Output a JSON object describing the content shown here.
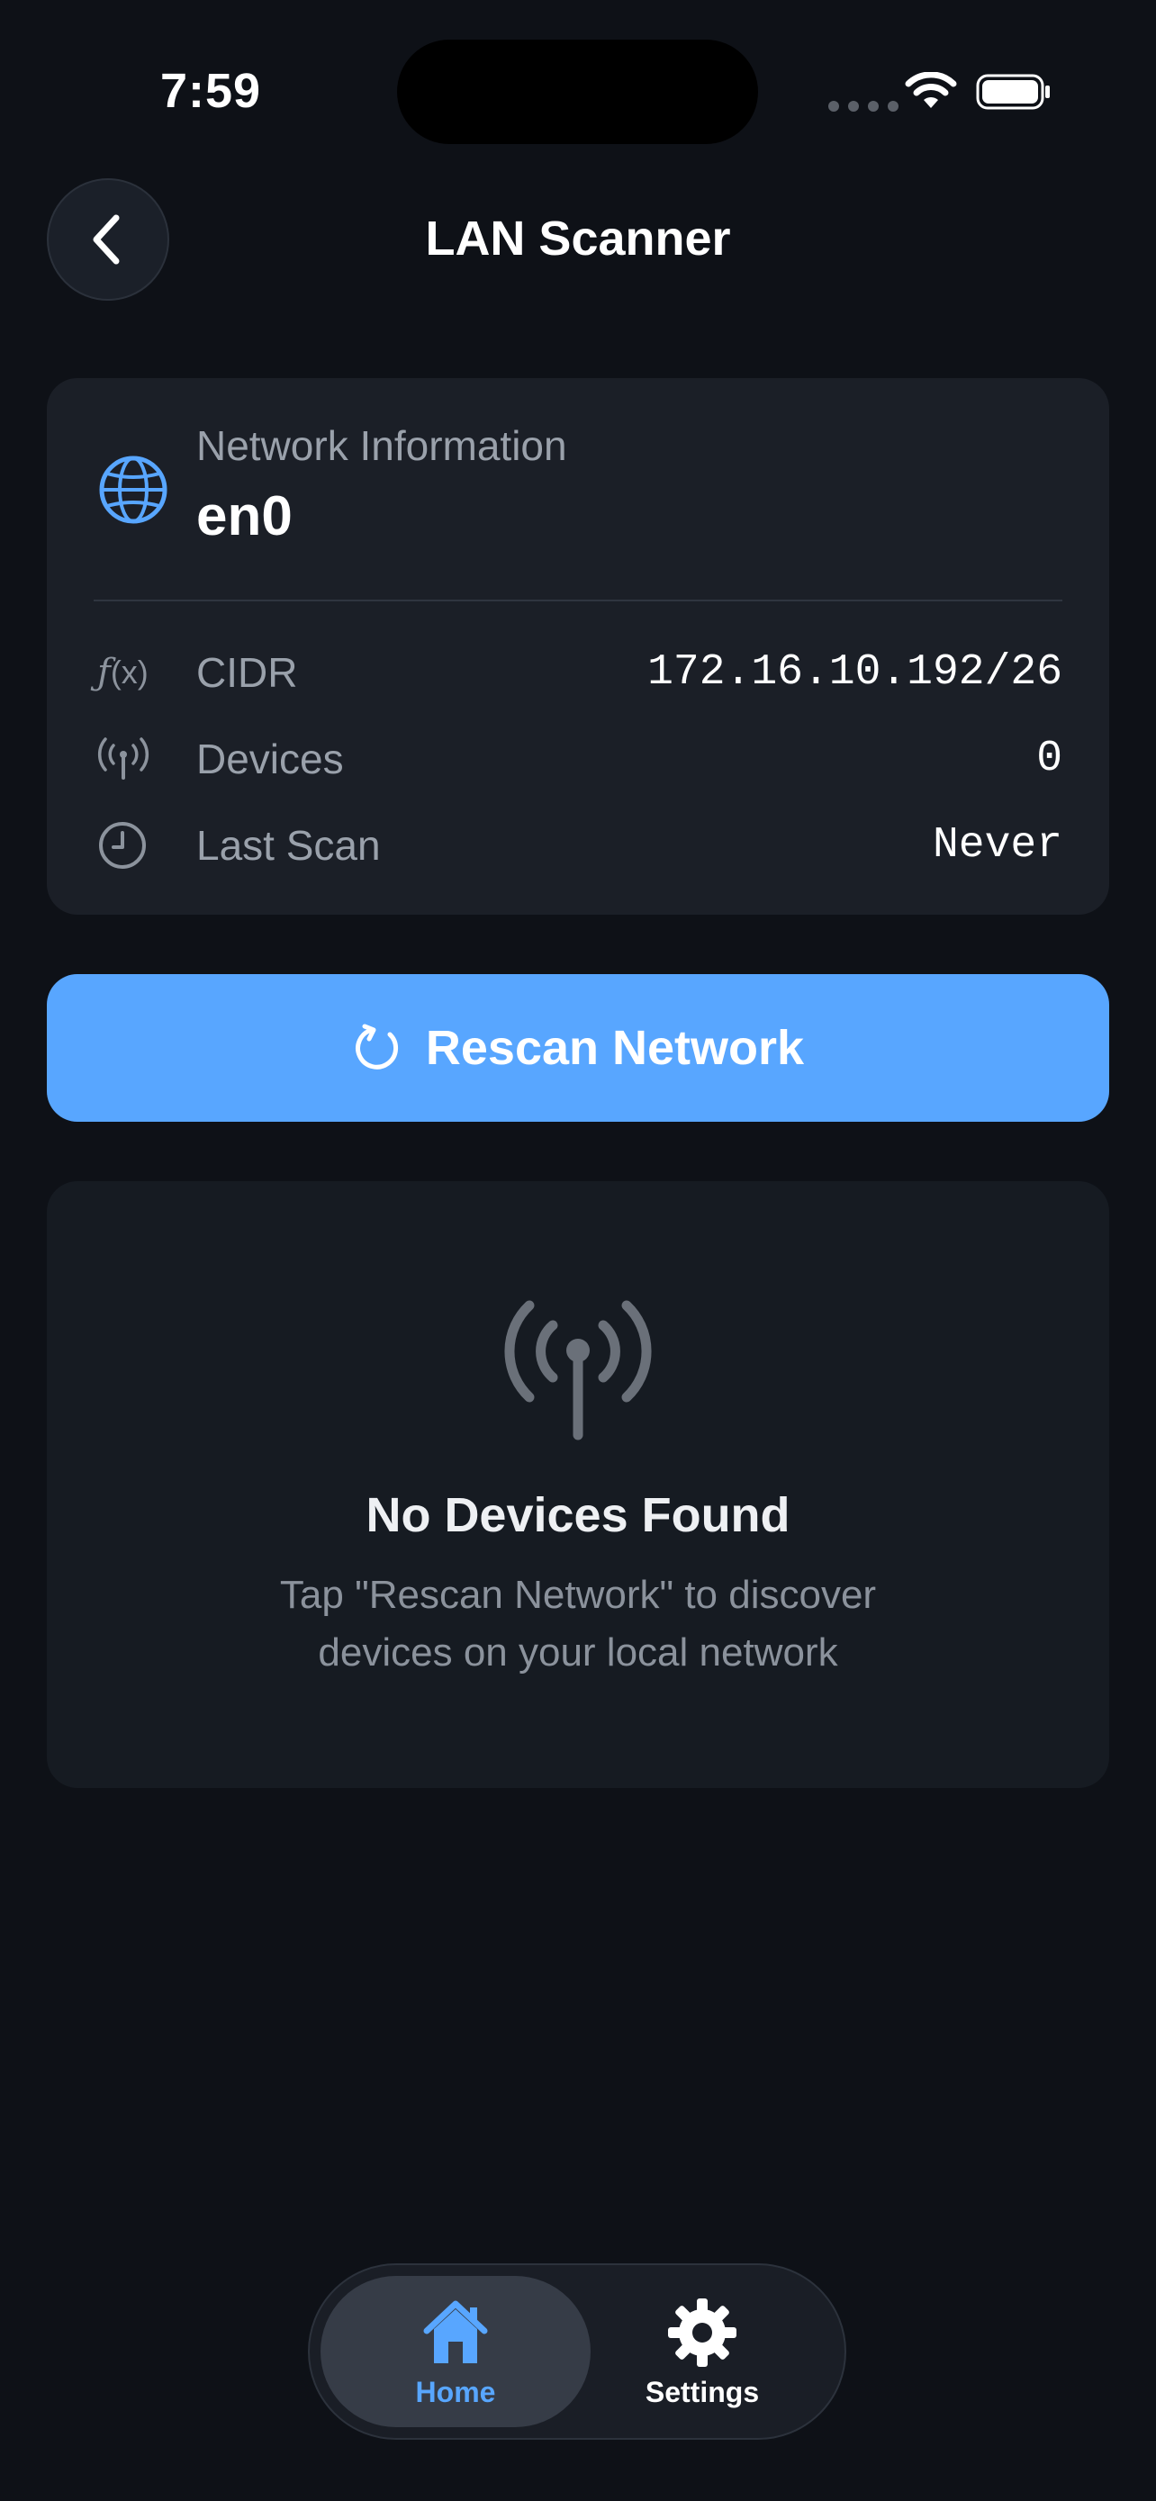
{
  "status_bar": {
    "time": "7:59"
  },
  "header": {
    "title": "LAN Scanner",
    "back_icon": "chevron-left-icon"
  },
  "network_info": {
    "label": "Network Information",
    "interface": "en0",
    "icon": "globe-icon",
    "rows": [
      {
        "icon": "function-icon",
        "label": "CIDR",
        "value": "172.16.10.192/26"
      },
      {
        "icon": "antenna-icon",
        "label": "Devices",
        "value": "0"
      },
      {
        "icon": "clock-icon",
        "label": "Last Scan",
        "value": "Never"
      }
    ]
  },
  "rescan_button": {
    "label": "Rescan Network",
    "icon": "refresh-icon"
  },
  "empty_state": {
    "icon": "antenna-icon",
    "title": "No Devices Found",
    "description_line1": "Tap \"Rescan Network\" to discover",
    "description_line2": "devices on your local network"
  },
  "tab_bar": {
    "tabs": [
      {
        "label": "Home",
        "icon": "house-icon",
        "selected": true
      },
      {
        "label": "Settings",
        "icon": "gear-icon",
        "selected": false
      }
    ]
  },
  "colors": {
    "background": "#0e1117",
    "card": "#1b1f27",
    "accent": "#58a6ff",
    "secondary_text": "#9aa1ab"
  }
}
